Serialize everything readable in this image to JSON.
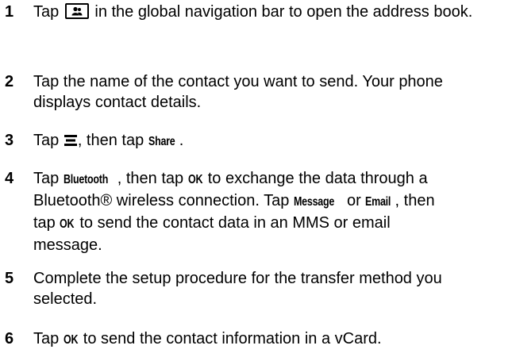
{
  "steps": [
    {
      "number": "1",
      "parts": [
        "Tap",
        "in the global navigation bar to open the address book."
      ],
      "icon": "address-book-icon"
    },
    {
      "number": "2",
      "line1": "Tap the name of the contact you want to send. Your phone",
      "line2": "displays contact details."
    },
    {
      "number": "3",
      "p1": "Tap",
      "p2": ", then tap",
      "ui_share": "Share",
      "p3": ".",
      "icon": "menu-icon"
    },
    {
      "number": "4",
      "l1a": "Tap",
      "ui_bluetooth": "Bluetooth",
      "l1b": ", then tap",
      "ui_ok1": "OK",
      "l1c": "to exchange the data through a",
      "l2a": "Bluetooth® wireless connection. Tap",
      "ui_message": "Message",
      "l2b": "or",
      "ui_email": "Email",
      "l2c": ", then",
      "l3a": "tap",
      "ui_ok2": "OK",
      "l3b": "to send the contact data in an MMS or email",
      "l4": "message."
    },
    {
      "number": "5",
      "line1": "Complete the setup procedure for the transfer method you",
      "line2": "selected."
    },
    {
      "number": "6",
      "p1": "Tap",
      "ui_ok": "OK",
      "p2": "to send the contact information in a vCard."
    }
  ]
}
